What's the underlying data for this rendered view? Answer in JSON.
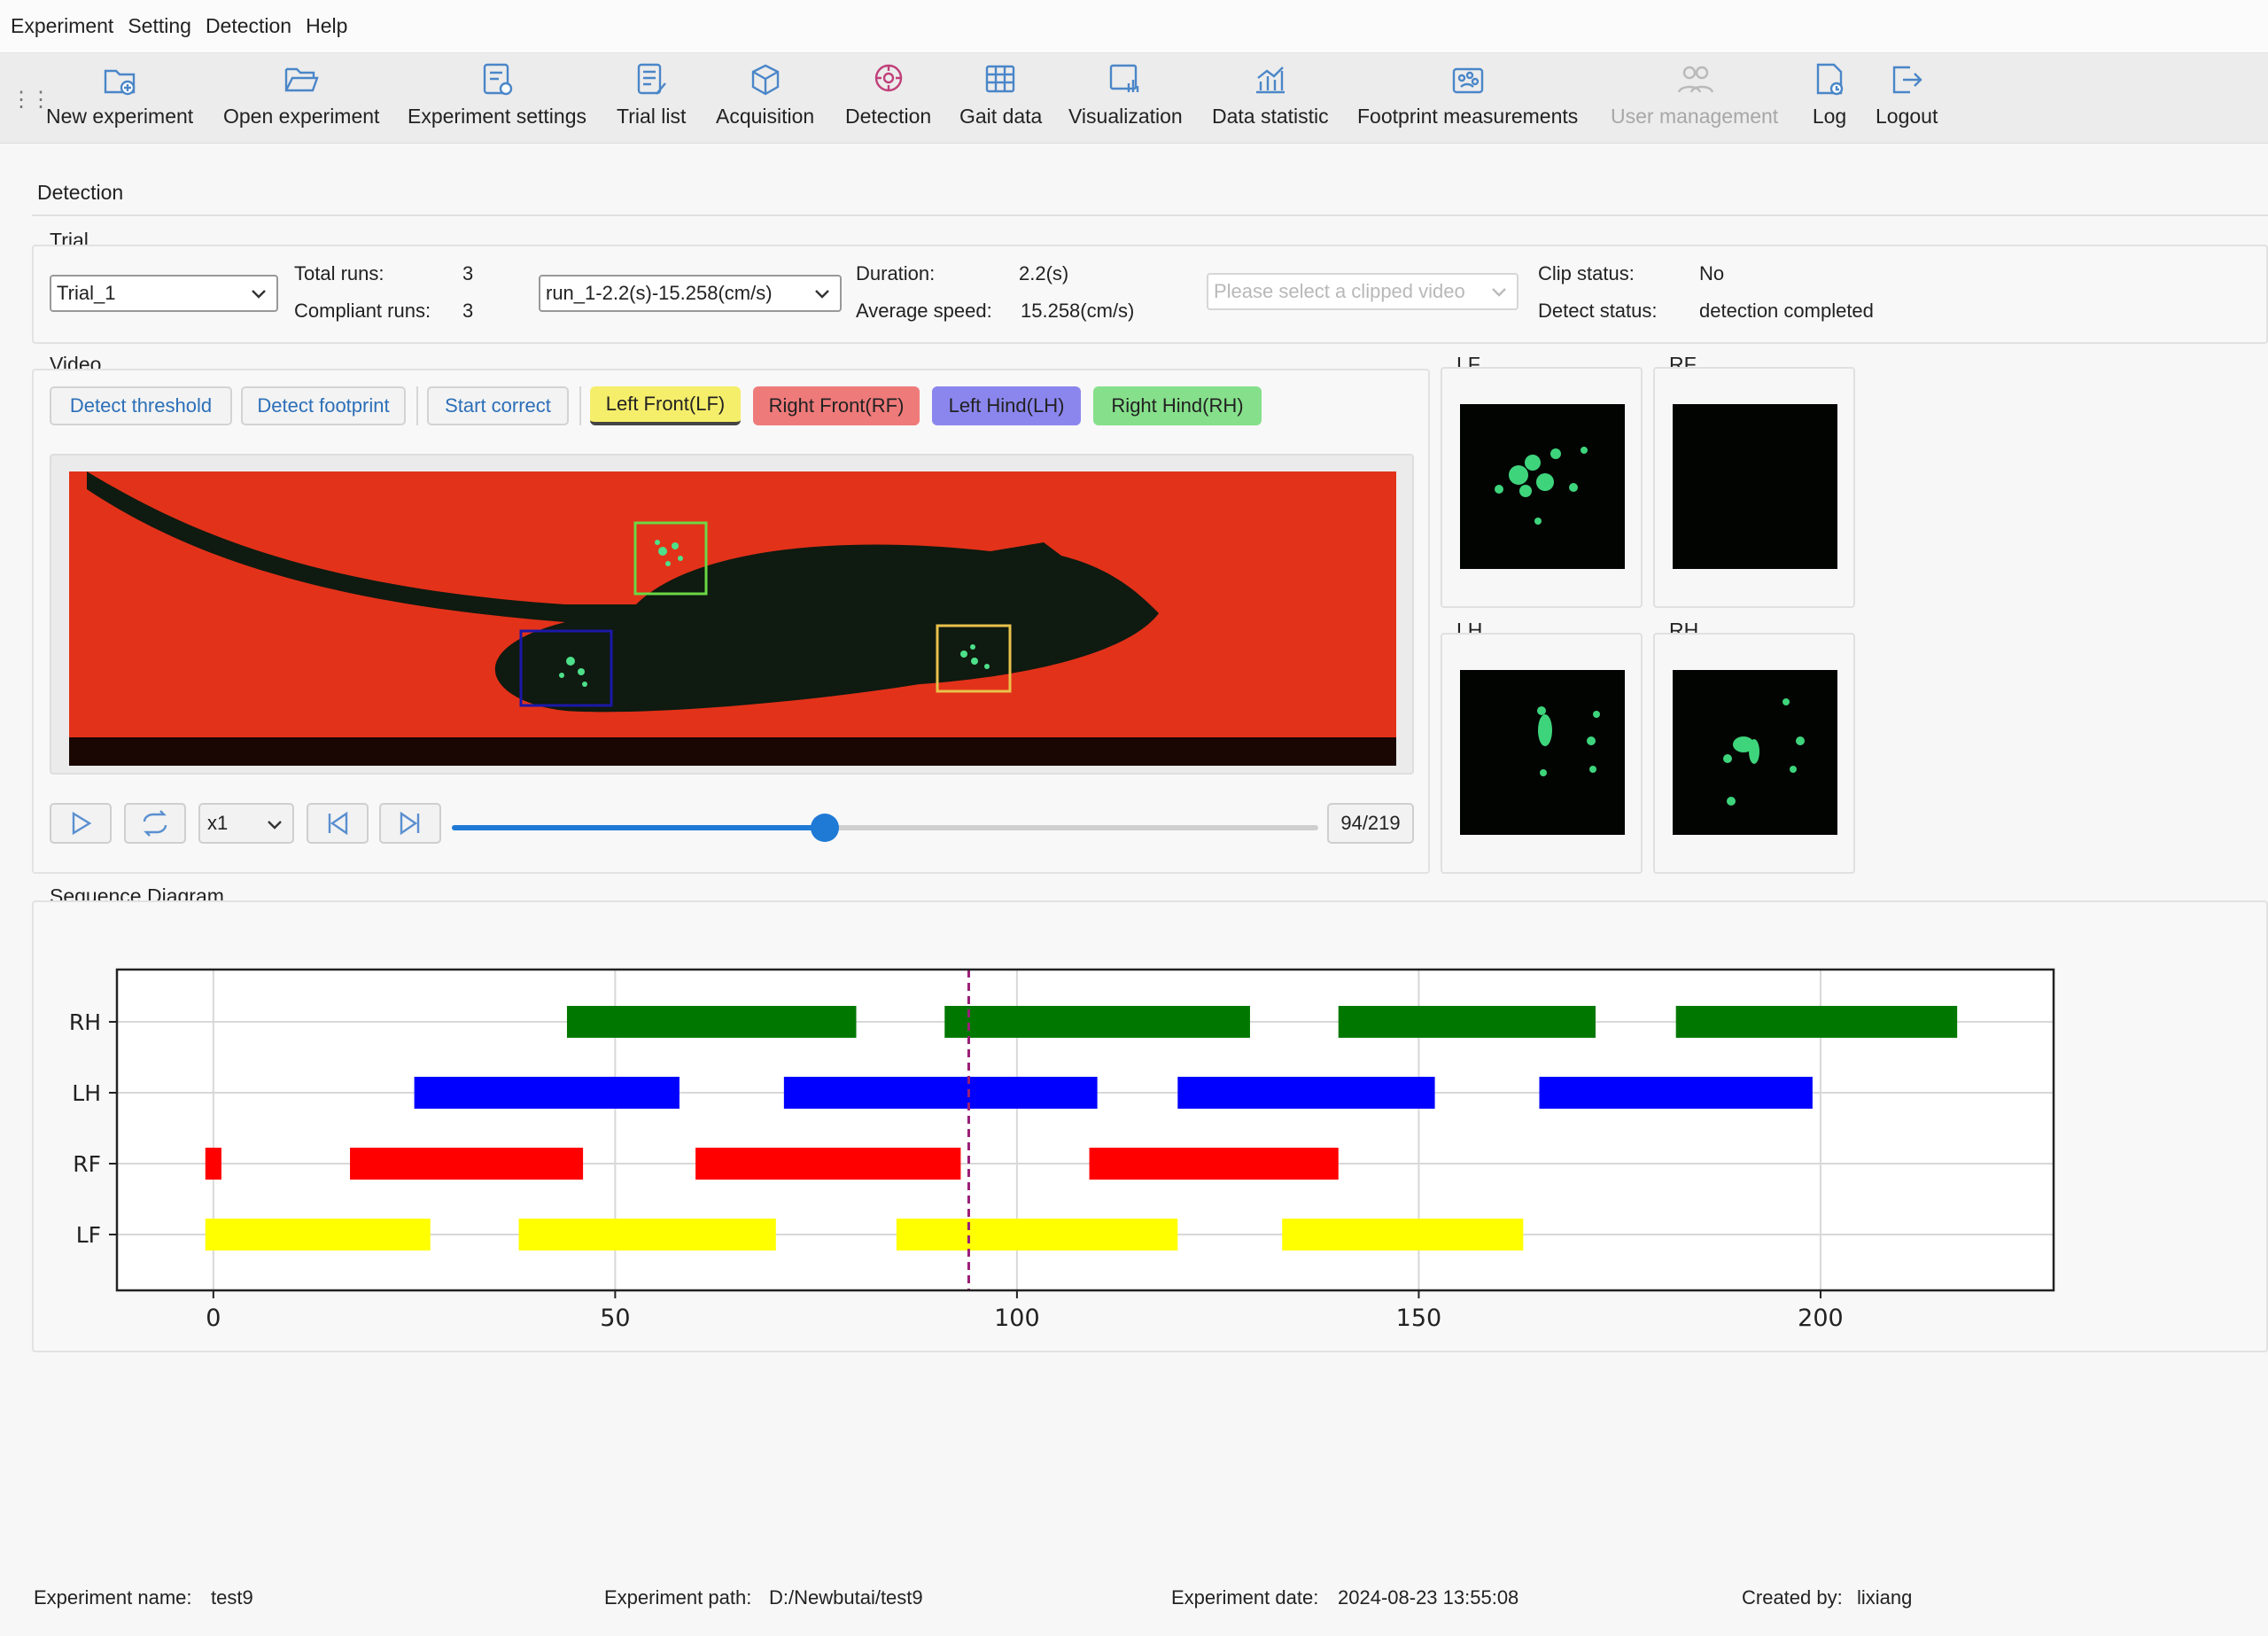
{
  "menu": [
    "Experiment",
    "Setting",
    "Detection",
    "Help"
  ],
  "toolbar": [
    {
      "label": "New experiment",
      "icon": "new-experiment-icon",
      "enabled": true
    },
    {
      "label": "Open experiment",
      "icon": "folder-open-icon",
      "enabled": true
    },
    {
      "label": "Experiment settings",
      "icon": "settings-doc-icon",
      "enabled": true
    },
    {
      "label": "Trial list",
      "icon": "list-doc-icon",
      "enabled": true
    },
    {
      "label": "Acquisition",
      "icon": "box-icon",
      "enabled": true
    },
    {
      "label": "Detection",
      "icon": "detection-icon",
      "enabled": true
    },
    {
      "label": "Gait data",
      "icon": "table-icon",
      "enabled": true
    },
    {
      "label": "Visualization",
      "icon": "visualization-icon",
      "enabled": true
    },
    {
      "label": "Data statistic",
      "icon": "statistic-icon",
      "enabled": true
    },
    {
      "label": "Footprint measurements",
      "icon": "footprint-icon",
      "enabled": true
    },
    {
      "label": "User management",
      "icon": "users-icon",
      "enabled": false
    },
    {
      "label": "Log",
      "icon": "log-icon",
      "enabled": true
    },
    {
      "label": "Logout",
      "icon": "logout-icon",
      "enabled": true
    }
  ],
  "page_title": "Detection",
  "trial": {
    "section": "Trial",
    "trial_select": "Trial_1",
    "total_runs_label": "Total runs:",
    "total_runs": "3",
    "compliant_runs_label": "Compliant runs:",
    "compliant_runs": "3",
    "run_select": "run_1-2.2(s)-15.258(cm/s)",
    "duration_label": "Duration:",
    "duration": "2.2(s)",
    "avg_speed_label": "Average speed:",
    "avg_speed": "15.258(cm/s)",
    "clip_placeholder": "Please select a clipped video",
    "clip_status_label": "Clip status:",
    "clip_status": "No",
    "detect_status_label": "Detect status:",
    "detect_status": "detection completed"
  },
  "video": {
    "section": "Video",
    "btn_threshold": "Detect threshold",
    "btn_footprint": "Detect footprint",
    "btn_correct": "Start correct",
    "paw_buttons": [
      {
        "label": "Left Front(LF)",
        "color": "#f5ee6a",
        "active": true
      },
      {
        "label": "Right Front(RF)",
        "color": "#ef7a7a"
      },
      {
        "label": "Left Hind(LH)",
        "color": "#8b86ee"
      },
      {
        "label": "Right Hind(RH)",
        "color": "#86e08b"
      }
    ],
    "speed": "x1",
    "frame_counter": "94/219",
    "progress": 0.43
  },
  "thumbs": {
    "lf": "LF",
    "rf": "RF",
    "lh": "LH",
    "rh": "RH"
  },
  "sequence_title": "Sequence Diagram",
  "chart_data": {
    "type": "gantt",
    "title": "",
    "xlabel": "",
    "ylabel": "",
    "xlim": [
      -12,
      229
    ],
    "xticks": [
      0,
      50,
      100,
      150,
      200
    ],
    "rows": [
      "RH",
      "LH",
      "RF",
      "LF"
    ],
    "current_frame": 94,
    "grid": true,
    "series": [
      {
        "name": "RH",
        "color": "#007800",
        "intervals": [
          [
            44,
            80
          ],
          [
            91,
            129
          ],
          [
            140,
            172
          ],
          [
            182,
            217
          ]
        ]
      },
      {
        "name": "LH",
        "color": "#0000ff",
        "intervals": [
          [
            25,
            58
          ],
          [
            71,
            110
          ],
          [
            120,
            152
          ],
          [
            165,
            199
          ]
        ]
      },
      {
        "name": "RF",
        "color": "#ff0000",
        "intervals": [
          [
            -1,
            1
          ],
          [
            17,
            46
          ],
          [
            60,
            93
          ],
          [
            109,
            140
          ]
        ]
      },
      {
        "name": "LF",
        "color": "#ffff00",
        "intervals": [
          [
            -1,
            27
          ],
          [
            38,
            70
          ],
          [
            85,
            120
          ],
          [
            133,
            163
          ]
        ]
      }
    ]
  },
  "footer": {
    "exp_name_label": "Experiment name:",
    "exp_name": "test9",
    "exp_path_label": "Experiment path:",
    "exp_path": "D:/Newbutai/test9",
    "exp_date_label": "Experiment date:",
    "exp_date": "2024-08-23 13:55:08",
    "created_by_label": "Created by:",
    "created_by": "lixiang"
  }
}
